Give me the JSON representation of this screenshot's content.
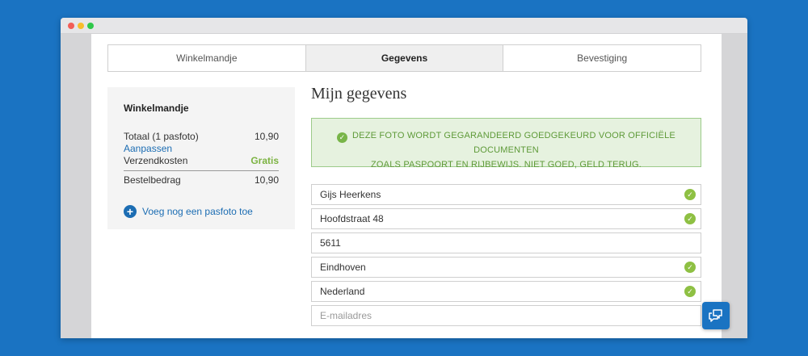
{
  "steps": [
    {
      "label": "Winkelmandje",
      "active": false
    },
    {
      "label": "Gegevens",
      "active": true
    },
    {
      "label": "Bevestiging",
      "active": false
    }
  ],
  "cart": {
    "title": "Winkelmandje",
    "total_label": "Totaal (1 pasfoto)",
    "total_value": "10,90",
    "edit_link": "Aanpassen",
    "shipping_label": "Verzendkosten",
    "shipping_value": "Gratis",
    "order_label": "Bestelbedrag",
    "order_value": "10,90",
    "add_label": "Voeg nog een pasfoto toe"
  },
  "form": {
    "heading": "Mijn gegevens",
    "banner_line1": "DEZE FOTO WORDT GEGARANDEERD GOEDGEKEURD VOOR OFFICIËLE DOCUMENTEN",
    "banner_line2": "ZOALS PASPOORT EN RIJBEWIJS. NIET GOED, GELD TERUG.",
    "fields": [
      {
        "value": "Gijs Heerkens",
        "valid": true
      },
      {
        "value": "Hoofdstraat 48",
        "valid": true
      },
      {
        "value": "5611",
        "valid": false
      },
      {
        "value": "Eindhoven",
        "valid": true
      },
      {
        "value": "Nederland",
        "valid": true
      }
    ],
    "email_placeholder": "E-mailadres"
  },
  "colors": {
    "background": "#1a73c2",
    "accent_blue": "#1c6db3",
    "success_green": "#7cb342"
  },
  "icons": {
    "valid": "check-circle-icon",
    "chat": "chat-icon",
    "add": "plus-circle-icon"
  }
}
